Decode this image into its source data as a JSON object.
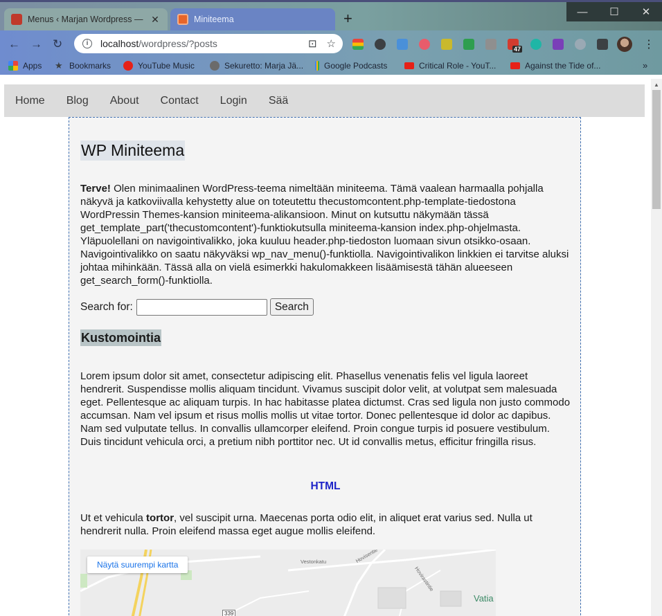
{
  "browser": {
    "tabs": [
      {
        "title": "Menus ‹ Marjan Wordpress — W",
        "active": false
      },
      {
        "title": "Miniteema",
        "active": true
      }
    ],
    "url_host": "localhost",
    "url_path": "/wordpress/?posts",
    "extension_badge": "47",
    "bookmarks": [
      {
        "label": "Apps",
        "icon": "apps-grid-icon",
        "color": "#e8453c"
      },
      {
        "label": "Bookmarks",
        "icon": "star-icon",
        "color": "#3c4043"
      },
      {
        "label": "YouTube Music",
        "icon": "youtube-music-icon",
        "color": "#e62117"
      },
      {
        "label": "Sekuretto: Marja Jä...",
        "icon": "globe-icon",
        "color": "#5f6368"
      },
      {
        "label": "Google Podcasts",
        "icon": "google-podcasts-icon",
        "color": "#fbbc04"
      },
      {
        "label": "Critical Role - YouT...",
        "icon": "youtube-icon",
        "color": "#e62117"
      },
      {
        "label": "Against the Tide of...",
        "icon": "youtube-icon",
        "color": "#e62117"
      }
    ]
  },
  "site": {
    "nav": [
      "Home",
      "Blog",
      "About",
      "Contact",
      "Login",
      "Sää"
    ],
    "title": "WP Miniteema",
    "intro_bold": "Terve!",
    "intro_text": " Olen minimaalinen WordPress-teema nimeltään miniteema. Tämä vaalean harmaalla pohjalla näkyvä ja katkoviivalla kehystetty alue on toteutettu thecustomcontent.php-template-tiedostona WordPressin Themes-kansion miniteema-alikansioon. Minut on kutsuttu näkymään tässä get_template_part('thecustomcontent')-funktiokutsulla miniteema-kansion index.php-ohjelmasta. Yläpuolellani on navigointivalikko, joka kuuluu header.php-tiedoston luomaan sivun otsikko-osaan. Navigointivalikko on saatu näkyväksi wp_nav_menu()-funktiolla. Navigointivalikon linkkien ei tarvitse aluksi johtaa mihinkään. Tässä alla on vielä esimerkki hakulomakkeen lisäämisestä tähän alueeseen get_search_form()-funktiolla.",
    "search_label": "Search for:",
    "search_value": "",
    "search_button": "Search",
    "section_title": "Kustomointia",
    "lorem": "Lorem ipsum dolor sit amet, consectetur adipiscing elit. Phasellus venenatis felis vel ligula laoreet hendrerit. Suspendisse mollis aliquam tincidunt. Vivamus suscipit dolor velit, at volutpat sem malesuada eget. Pellentesque ac aliquam turpis. In hac habitasse platea dictumst. Cras sed ligula non justo commodo accumsan. Nam vel ipsum et risus mollis mollis ut vitae tortor. Donec pellentesque id dolor ac dapibus. Nam sed vulputate tellus. In convallis ullamcorper eleifend. Proin congue turpis id posuere vestibulum. Duis tincidunt vehicula orci, a pretium nibh porttitor nec. Ut id convallis metus, efficitur fringilla risus.",
    "html_link": "HTML",
    "tortor_before": "Ut et vehicula ",
    "tortor_bold": "tortor",
    "tortor_after": ", vel suscipit urna. Maecenas porta odio elit, in aliquet erat varius sed. Nulla ut hendrerit nulla. Proin eleifend massa eget augue mollis eleifend.",
    "map": {
      "button": "Näytä suurempi kartta",
      "place": "Vatia",
      "road_number": "339",
      "street_labels": [
        "Vestonkatu",
        "Hovisentie",
        "Hovirastintie"
      ]
    }
  }
}
